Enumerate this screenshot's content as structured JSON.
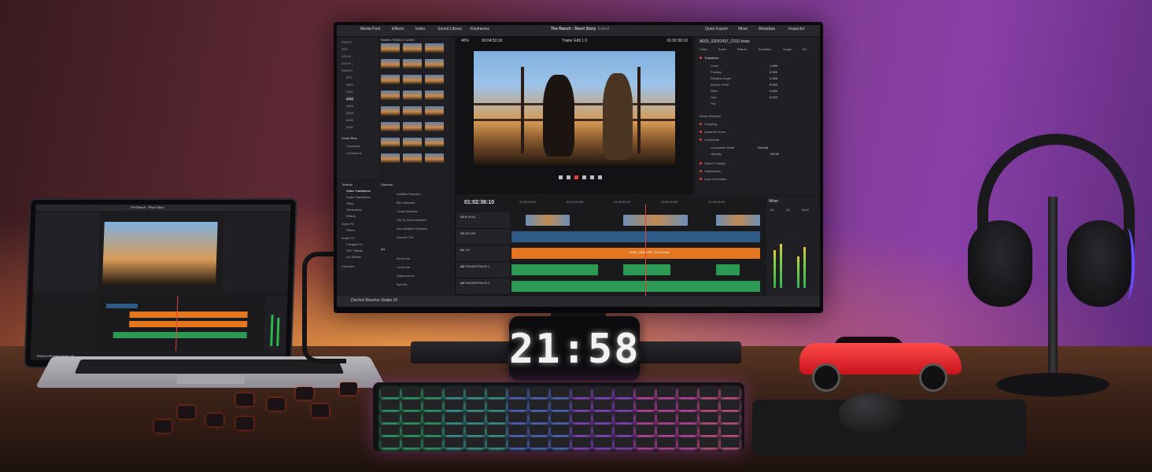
{
  "monitor": {
    "topbar": {
      "media_pool": "Media Pool",
      "effects": "Effects",
      "edit_index": "Index",
      "sound_library": "Sound Library",
      "keyframes": "Keyframes",
      "project_title": "The Ranch - Short Story",
      "edited": "Edited",
      "quick_export": "Quick Export",
      "mixer": "Mixer",
      "metadata": "Metadata",
      "inspector": "Inspector"
    },
    "media_pool": {
      "breadcrumb": "Master / RANCH / A003",
      "bins": [
        "FOLEY",
        "SFX",
        "ICELA...",
        "OLD R...",
        "RANCH",
        "BTS",
        "A001",
        "A002",
        "A003",
        "A004",
        "A005",
        "A006",
        "A007"
      ],
      "smart_bins_label": "Smart Bins",
      "smart_bins": [
        "Keywords",
        "Collections"
      ]
    },
    "viewer": {
      "zoom": "46%",
      "source_tc": "00:04:53:10",
      "timeline_name": "Trailer Edit 1.0",
      "timecode": "01:02:36:10"
    },
    "inspector": {
      "clip_name": "A003_02091437_C012.braw",
      "tabs": [
        "Video",
        "Audio",
        "Effects",
        "Transition",
        "Image",
        "File"
      ],
      "transform_label": "Transform",
      "rows": [
        {
          "label": "Zoom",
          "value": "1.000"
        },
        {
          "label": "Position",
          "value": "0.000"
        },
        {
          "label": "Rotation Angle",
          "value": "0.000"
        },
        {
          "label": "Anchor Point",
          "value": "0.000"
        },
        {
          "label": "Pitch",
          "value": "0.000"
        },
        {
          "label": "Yaw",
          "value": "0.000"
        },
        {
          "label": "Flip",
          "value": ""
        }
      ],
      "sections": [
        "Smart Reframe",
        "Cropping",
        "Dynamic Zoom",
        "Composite",
        "Speed Change",
        "Stabilization",
        "Lens Correction"
      ],
      "composite_mode_label": "Composite Mode",
      "composite_mode_value": "Normal",
      "opacity_label": "Opacity",
      "opacity_value": "100.00"
    },
    "effects_panel": {
      "toolbox_label": "Toolbox",
      "categories": [
        "Video Transitions",
        "Audio Transitions",
        "Titles",
        "Generators",
        "Effects",
        "Open FX",
        "Filters",
        "Audio FX",
        "Fairlight FX",
        "VST Effects",
        "AU Effects",
        "Favorites"
      ],
      "dissolve_label": "Dissolve",
      "dissolves": [
        "Additive Dissolve",
        "Blur Dissolve",
        "Cross Dissolve",
        "Dip To Color Dissolve",
        "Non-Additive Dissolve",
        "Smooth Cut"
      ],
      "iris_label": "Iris",
      "iris_items": [
        "Arrow Iris",
        "Cross Iris",
        "Diamond Iris",
        "Eye Iris"
      ]
    },
    "timeline": {
      "timecode": "01:02:36:10",
      "ruler": [
        "01:02:16:00",
        "01:02:24:00",
        "01:02:32:00",
        "01:02:40:00",
        "01:02:48:00"
      ],
      "tracks": [
        {
          "id": "V2",
          "name": "B ROLL"
        },
        {
          "id": "V1",
          "name": "DYLAN"
        },
        {
          "id": "A1",
          "name": "VO"
        },
        {
          "id": "A2",
          "name": "SOUNDTRACK 1"
        },
        {
          "id": "A3",
          "name": "SOUNDTRACK 2"
        }
      ],
      "clip_label": "A003_02091437_C012.braw"
    },
    "mixer": {
      "title": "Mixer",
      "channels": [
        "A1",
        "A2",
        "Bus1"
      ],
      "levels": [
        0.6,
        0.7,
        0.5,
        0.65
      ]
    },
    "status": "DaVinci Resolve Studio 20"
  },
  "clock": {
    "time": "21:58"
  },
  "laptop": {
    "project_title": "The Ranch - Short Story",
    "status": "DaVinci Resolve Studio 20"
  }
}
